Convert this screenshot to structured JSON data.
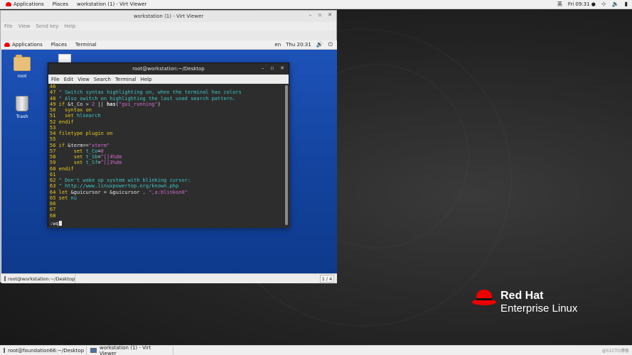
{
  "host": {
    "topbar": {
      "applications": "Applications",
      "places": "Places",
      "active_window": "workstation (1) - Virt Viewer",
      "input_method": "英",
      "clock": "Fri 09:31 ●"
    },
    "taskbar": [
      {
        "label": "root@foundation66:~/Desktop"
      },
      {
        "label": "workstation (1) - Virt Viewer"
      }
    ],
    "watermark": "@51CTO博客",
    "logo": {
      "line1": "Red Hat",
      "line2": "Enterprise Linux"
    }
  },
  "viewer": {
    "title": "workstation (1) - Virt Viewer",
    "menu": [
      "File",
      "View",
      "Send key",
      "Help"
    ],
    "controls": {
      "minimize": "–",
      "maximize": "▫",
      "close": "✕"
    }
  },
  "guest": {
    "topbar": {
      "applications": "Applications",
      "places": "Places",
      "terminal": "Terminal",
      "lang": "en",
      "clock": "Thu 20:31"
    },
    "desktop_icons": [
      {
        "label": "root"
      },
      {
        "label": ""
      },
      {
        "label": "Trash"
      }
    ],
    "taskbar": {
      "item": "root@workstation:~/Desktop",
      "pager": "1 / 4"
    }
  },
  "terminal": {
    "title": "root@workstation:~/Desktop",
    "menu": [
      "File",
      "Edit",
      "View",
      "Search",
      "Terminal",
      "Help"
    ],
    "controls": {
      "minimize": "–",
      "maximize": "▫",
      "close": "✕"
    },
    "lines": [
      {
        "n": "46",
        "parts": []
      },
      {
        "n": "47",
        "parts": [
          {
            "c": "cm",
            "t": " \" Switch syntax highlighting on, when the terminal has colors"
          }
        ]
      },
      {
        "n": "48",
        "parts": [
          {
            "c": "cm",
            "t": " \" Also switch on highlighting the last used search pattern."
          }
        ]
      },
      {
        "n": "49",
        "parts": [
          {
            "c": "kw",
            "t": " if "
          },
          {
            "c": "op",
            "t": "&t_Co > "
          },
          {
            "c": "nm",
            "t": "2"
          },
          {
            "c": "op",
            "t": " || "
          },
          {
            "c": "fn",
            "t": "has"
          },
          {
            "c": "op",
            "t": "("
          },
          {
            "c": "st",
            "t": "\"gui_running\""
          },
          {
            "c": "op",
            "t": ")"
          }
        ]
      },
      {
        "n": "50",
        "parts": [
          {
            "c": "kw",
            "t": "   syntax on"
          }
        ]
      },
      {
        "n": "51",
        "parts": [
          {
            "c": "kw",
            "t": "   set "
          },
          {
            "c": "cm",
            "t": "hlsearch"
          }
        ]
      },
      {
        "n": "52",
        "parts": [
          {
            "c": "kw",
            "t": " endif"
          }
        ]
      },
      {
        "n": "53",
        "parts": []
      },
      {
        "n": "54",
        "parts": [
          {
            "c": "kw",
            "t": " filetype plugin on"
          }
        ]
      },
      {
        "n": "55",
        "parts": []
      },
      {
        "n": "56",
        "parts": [
          {
            "c": "kw",
            "t": " if "
          },
          {
            "c": "op",
            "t": "&term=="
          },
          {
            "c": "st",
            "t": "\"xterm\""
          }
        ]
      },
      {
        "n": "57",
        "parts": [
          {
            "c": "kw",
            "t": "      set "
          },
          {
            "c": "cm",
            "t": "t_Co"
          },
          {
            "c": "op",
            "t": "="
          },
          {
            "c": "nm",
            "t": "8"
          }
        ]
      },
      {
        "n": "58",
        "parts": [
          {
            "c": "kw",
            "t": "      set "
          },
          {
            "c": "cm",
            "t": "t_Sb"
          },
          {
            "c": "op",
            "t": "="
          },
          {
            "c": "st",
            "t": "^[[4%dm"
          }
        ]
      },
      {
        "n": "59",
        "parts": [
          {
            "c": "kw",
            "t": "      set "
          },
          {
            "c": "cm",
            "t": "t_Sf"
          },
          {
            "c": "op",
            "t": "="
          },
          {
            "c": "st",
            "t": "^[[3%dm"
          }
        ]
      },
      {
        "n": "60",
        "parts": [
          {
            "c": "kw",
            "t": " endif"
          }
        ]
      },
      {
        "n": "61",
        "parts": []
      },
      {
        "n": "62",
        "parts": [
          {
            "c": "cm",
            "t": " \" Don't wake up system with blinking cursor:"
          }
        ]
      },
      {
        "n": "63",
        "parts": [
          {
            "c": "cm",
            "t": " \" http://www.linuxpowertop.org/known.php"
          }
        ]
      },
      {
        "n": "64",
        "parts": [
          {
            "c": "kw",
            "t": " let "
          },
          {
            "c": "op",
            "t": "&guicursor = &guicursor . "
          },
          {
            "c": "st",
            "t": "\",a:blinkon0\""
          }
        ]
      },
      {
        "n": "65",
        "parts": [
          {
            "c": "kw",
            "t": " set "
          },
          {
            "c": "cm",
            "t": "nu"
          }
        ]
      },
      {
        "n": "66",
        "parts": []
      },
      {
        "n": "67",
        "parts": []
      },
      {
        "n": "68",
        "parts": []
      }
    ],
    "cmdline": ":wq"
  }
}
